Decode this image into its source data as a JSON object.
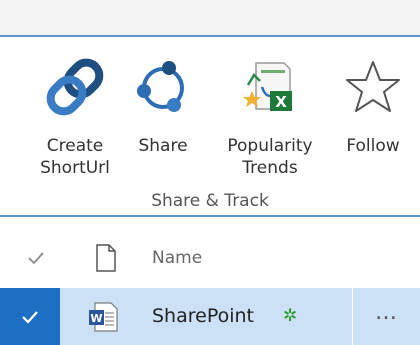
{
  "ribbon": {
    "buttons": {
      "create_short_url": {
        "label": "Create\nShortUrl",
        "icon": "chain-link-icon"
      },
      "share": {
        "label": "Share",
        "icon": "share-network-icon"
      },
      "popularity_trends": {
        "label": "Popularity\nTrends",
        "icon": "excel-trends-icon"
      },
      "follow": {
        "label": "Follow",
        "icon": "star-icon"
      }
    },
    "group_label": "Share & Track"
  },
  "list": {
    "header": {
      "name_label": "Name"
    },
    "rows": [
      {
        "name": "SharePoint",
        "new_badge": "✲",
        "more": "…",
        "selected": true
      }
    ]
  },
  "colors": {
    "accent": "#1c6fc3",
    "ribbon_border": "#5b93d3",
    "selected_row": "#cce1f5",
    "new_badge": "#2a9a2a"
  }
}
